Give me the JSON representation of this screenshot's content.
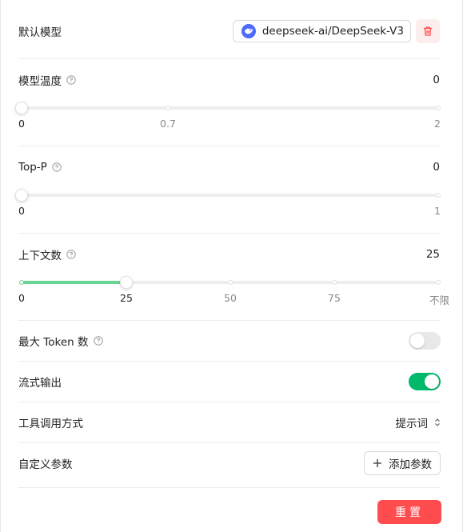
{
  "default_model": {
    "label": "默认模型",
    "model_name": "deepseek-ai/DeepSeek-V3"
  },
  "temperature": {
    "label": "模型温度",
    "value": "0",
    "slider_value": 0,
    "slider_min": 0,
    "slider_max": 2,
    "marks": [
      "0",
      "0.7",
      "2"
    ]
  },
  "top_p": {
    "label": "Top-P",
    "value": "0",
    "slider_value": 0,
    "slider_min": 0,
    "slider_max": 1,
    "marks": [
      "0",
      "1"
    ]
  },
  "context": {
    "label": "上下文数",
    "value": "25",
    "slider_value": 25,
    "marks": [
      "0",
      "25",
      "50",
      "75",
      "不限"
    ]
  },
  "max_token": {
    "label": "最大 Token 数",
    "enabled": false
  },
  "stream_output": {
    "label": "流式输出",
    "enabled": true
  },
  "tool_call": {
    "label": "工具调用方式",
    "selected": "提示词"
  },
  "custom_params": {
    "label": "自定义参数",
    "add_label": "添加参数"
  },
  "reset": {
    "label": "重置"
  },
  "colors": {
    "accent_green": "#00b96b",
    "slider_fill": "#6ad592",
    "danger": "#ff4d4f",
    "model_logo": "#4d6bfe"
  }
}
